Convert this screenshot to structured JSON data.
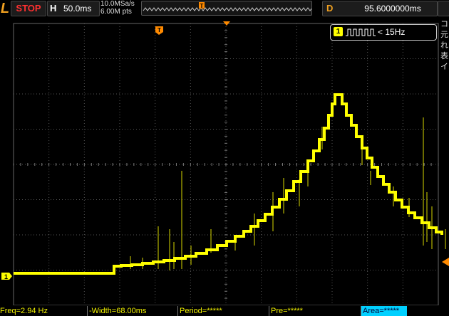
{
  "colors": {
    "trace": "#ffff00",
    "trigger_marker": "#ff8a00",
    "brand": "#f0a020",
    "stop": "#ff3030",
    "area_active": "#00d0ff"
  },
  "topbar": {
    "brand": "L",
    "run_status": "STOP",
    "horizontal_key": "H",
    "timebase": "50.0ms",
    "sample_rate": "10.0MSa/s",
    "memory_depth": "6.00M pts",
    "memory_marker": "T",
    "delay_key": "D",
    "delay_value": "95.6000000ms"
  },
  "waveform": {
    "trigger_marker": "T",
    "trigger_info": {
      "channel": "1",
      "text": "< 15Hz",
      "icon": "pulse-width-trigger-icon"
    },
    "channel_marker": "1",
    "side_glyphs": "コ\n元\nれ\n表\nイ"
  },
  "measurements": {
    "freq": "Freq=2.94 Hz",
    "width": "-Width=68.00ms",
    "period": "Period=*****",
    "pre": "Pre=*****",
    "area": "Area=*****"
  }
}
